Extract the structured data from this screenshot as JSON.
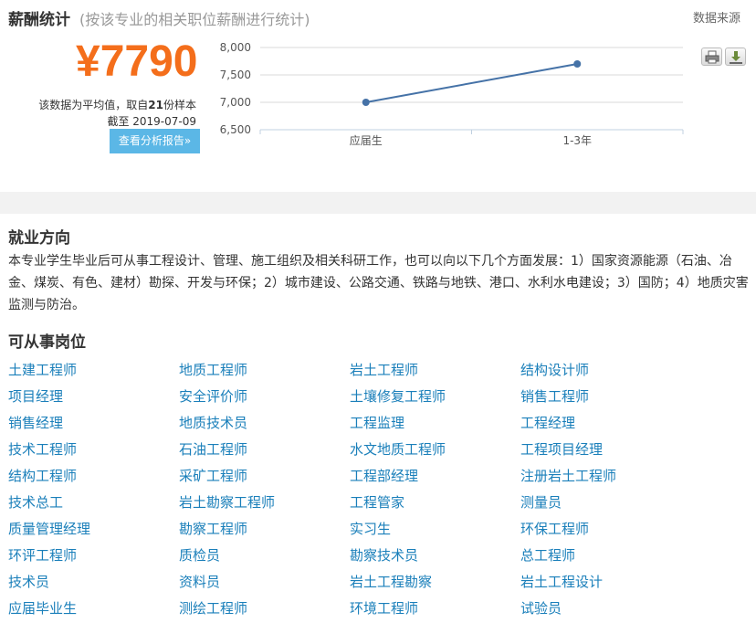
{
  "salary": {
    "title": "薪酬统计",
    "subtitle": "(按该专业的相关职位薪酬进行统计)",
    "data_source": "数据来源",
    "amount": "¥7790",
    "avg_note_prefix": "该数据为平均值，取自",
    "sample_count": "21",
    "avg_note_suffix": "份样本",
    "date_note": "截至 2019-07-09",
    "report_button": "查看分析报告»"
  },
  "chart_data": {
    "type": "line",
    "categories": [
      "应届生",
      "1-3年"
    ],
    "values": [
      7000,
      7700
    ],
    "yticks": [
      "8,000",
      "7,500",
      "7,000",
      "6,500"
    ],
    "ylim": [
      6500,
      8000
    ],
    "grid": true,
    "colors": {
      "line": "#4572a7"
    }
  },
  "toolbar_icons": [
    "print-icon",
    "download-icon"
  ],
  "employment": {
    "title": "就业方向",
    "text": "本专业学生毕业后可从事工程设计、管理、施工组织及相关科研工作，也可以向以下几个方面发展：1）国家资源能源（石油、冶金、煤炭、有色、建材）勘探、开发与环保；2）城市建设、公路交通、铁路与地铁、港口、水利水电建设；3）国防；4）地质灾害监测与防治。"
  },
  "jobs": {
    "title": "可从事岗位",
    "items": [
      "土建工程师",
      "地质工程师",
      "岩土工程师",
      "结构设计师",
      "项目经理",
      "安全评价师",
      "土壤修复工程师",
      "销售工程师",
      "销售经理",
      "地质技术员",
      "工程监理",
      "工程经理",
      "技术工程师",
      "石油工程师",
      "水文地质工程师",
      "工程项目经理",
      "结构工程师",
      "采矿工程师",
      "工程部经理",
      "注册岩土工程师",
      "技术总工",
      "岩土勘察工程师",
      "工程管家",
      "测量员",
      "质量管理经理",
      "勘察工程师",
      "实习生",
      "环保工程师",
      "环评工程师",
      "质检员",
      "勘察技术员",
      "总工程师",
      "技术员",
      "资料员",
      "岩土工程勘察",
      "岩土工程设计",
      "应届毕业生",
      "测绘工程师",
      "环境工程师",
      "试验员"
    ]
  }
}
